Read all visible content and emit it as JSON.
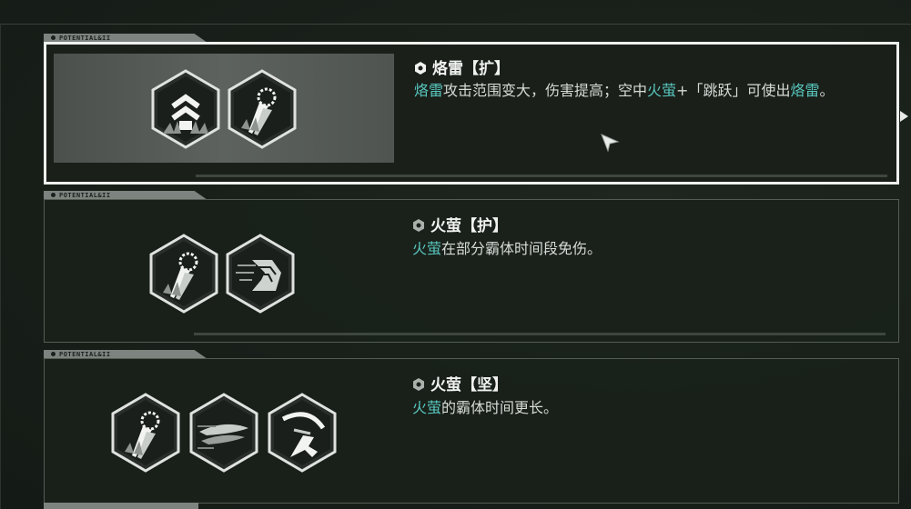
{
  "colors": {
    "keyword": "#58c7be",
    "text": "#d7dbd7",
    "title": "#f0f2f0",
    "panel_border_selected": "#eef0ee",
    "panel_border": "#545c54"
  },
  "cards": [
    {
      "tab_label": "POTENTIAL&II",
      "title": "烙雷【扩】",
      "desc_parts": [
        {
          "text": "烙雷",
          "kw": true
        },
        {
          "text": "攻击范围变大，伤害提高；空中",
          "kw": false
        },
        {
          "text": "火萤",
          "kw": true
        },
        {
          "text": "+「跳跃」可使出",
          "kw": false
        },
        {
          "text": "烙雷",
          "kw": true
        },
        {
          "text": "。",
          "kw": false
        }
      ],
      "icons": [
        "chevron-up-icon",
        "fire-burst-icon"
      ],
      "selected": true
    },
    {
      "tab_label": "POTENTIAL&II",
      "title": "火萤【护】",
      "desc_parts": [
        {
          "text": "火萤",
          "kw": true
        },
        {
          "text": "在部分霸体时间段免伤。",
          "kw": false
        }
      ],
      "icons": [
        "fire-burst-icon",
        "dash-boots-icon"
      ],
      "selected": false
    },
    {
      "tab_label": "POTENTIAL&II",
      "title": "火萤【坚】",
      "desc_parts": [
        {
          "text": "火萤",
          "kw": true
        },
        {
          "text": "的霸体时间更长。",
          "kw": false
        }
      ],
      "icons": [
        "fire-burst-icon",
        "speed-trail-icon",
        "slash-kick-icon"
      ],
      "selected": false
    }
  ]
}
